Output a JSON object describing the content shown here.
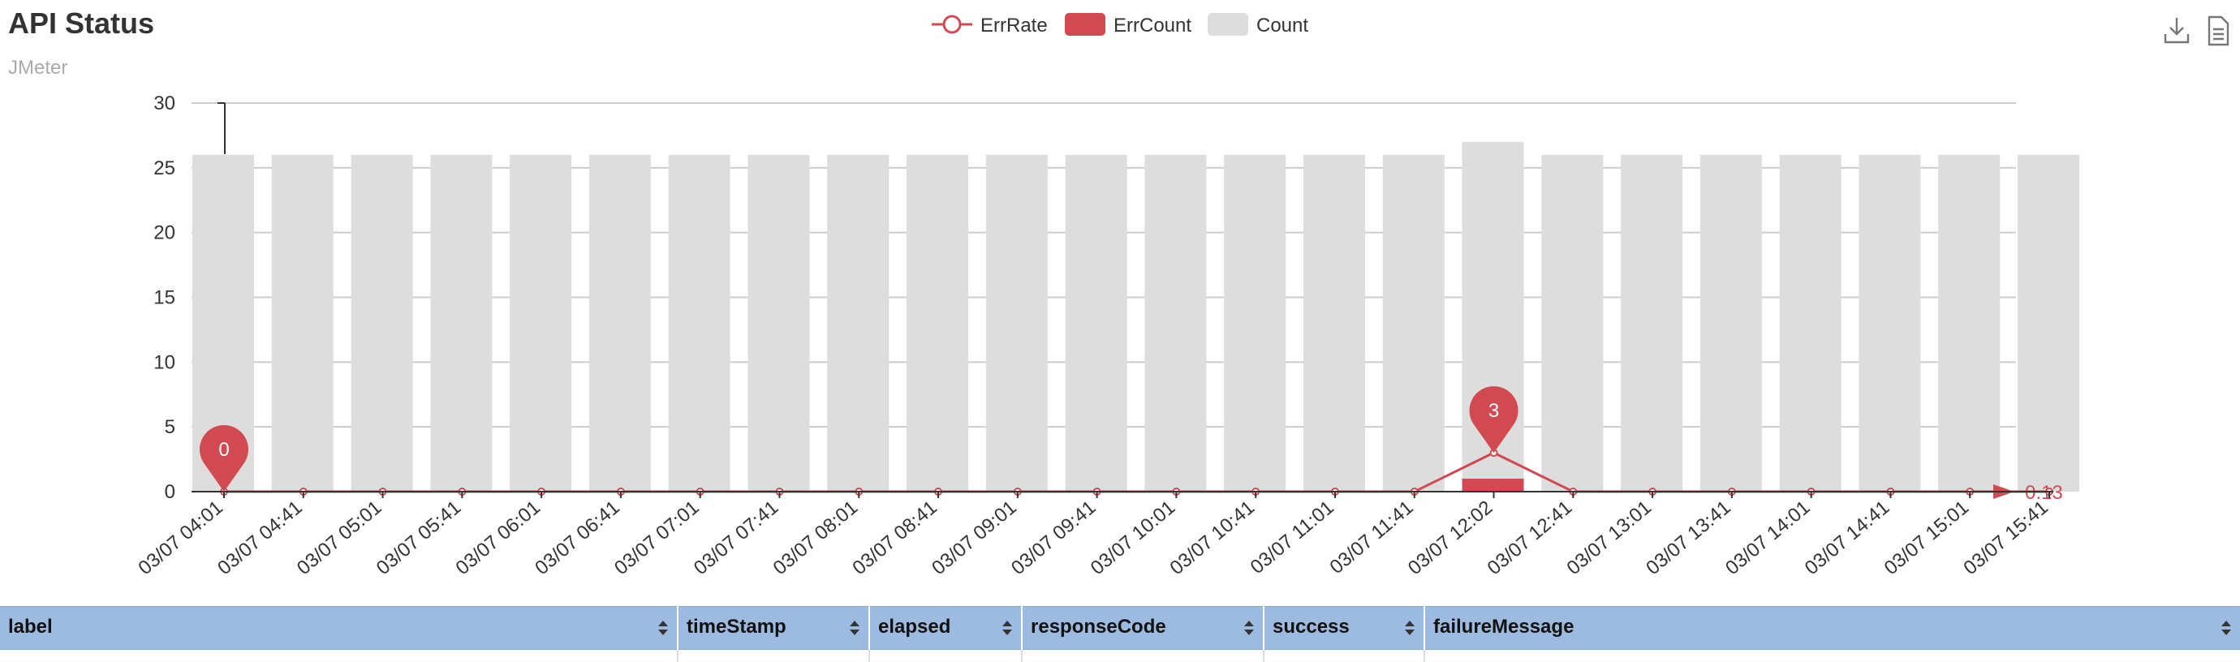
{
  "header": {
    "title": "API Status",
    "subtitle": "JMeter"
  },
  "toolbar": {
    "download_icon": "download-icon",
    "data_view_icon": "document-icon"
  },
  "colors": {
    "err": "#d14a52",
    "count": "#dddddd",
    "grid": "#cccccc",
    "axis": "#333333"
  },
  "chart_data": {
    "type": "bar",
    "categories": [
      "03/07 04:01",
      "03/07 04:41",
      "03/07 05:01",
      "03/07 05:41",
      "03/07 06:01",
      "03/07 06:41",
      "03/07 07:01",
      "03/07 07:41",
      "03/07 08:01",
      "03/07 08:41",
      "03/07 09:01",
      "03/07 09:41",
      "03/07 10:01",
      "03/07 10:41",
      "03/07 11:01",
      "03/07 11:41",
      "03/07 12:02",
      "03/07 12:41",
      "03/07 13:01",
      "03/07 13:41",
      "03/07 14:01",
      "03/07 14:41",
      "03/07 15:01",
      "03/07 15:41"
    ],
    "series": [
      {
        "name": "ErrRate",
        "kind": "line",
        "values": [
          0,
          0,
          0,
          0,
          0,
          0,
          0,
          0,
          0,
          0,
          0,
          0,
          0,
          0,
          0,
          0,
          3,
          0,
          0,
          0,
          0,
          0,
          0,
          0
        ]
      },
      {
        "name": "ErrCount",
        "kind": "bar",
        "values": [
          0,
          0,
          0,
          0,
          0,
          0,
          0,
          0,
          0,
          0,
          0,
          0,
          0,
          0,
          0,
          0,
          1,
          0,
          0,
          0,
          0,
          0,
          0,
          0
        ]
      },
      {
        "name": "Count",
        "kind": "bar",
        "values": [
          26,
          26,
          26,
          26,
          26,
          26,
          26,
          26,
          26,
          26,
          26,
          26,
          26,
          26,
          26,
          26,
          27,
          26,
          26,
          26,
          26,
          26,
          26,
          26
        ]
      }
    ],
    "y_ticks": [
      "0",
      "5",
      "10",
      "15",
      "20",
      "25",
      "30"
    ],
    "ylim": [
      0,
      30
    ],
    "markers": [
      {
        "label": "0",
        "index": 0,
        "value": 0
      },
      {
        "label": "3",
        "index": 16,
        "value": 3
      }
    ],
    "mark_line_label": "0.13",
    "grid": true,
    "legend_position": "top-center"
  },
  "table": {
    "columns": [
      "label",
      "timeStamp",
      "elapsed",
      "responseCode",
      "success",
      "failureMessage"
    ]
  }
}
